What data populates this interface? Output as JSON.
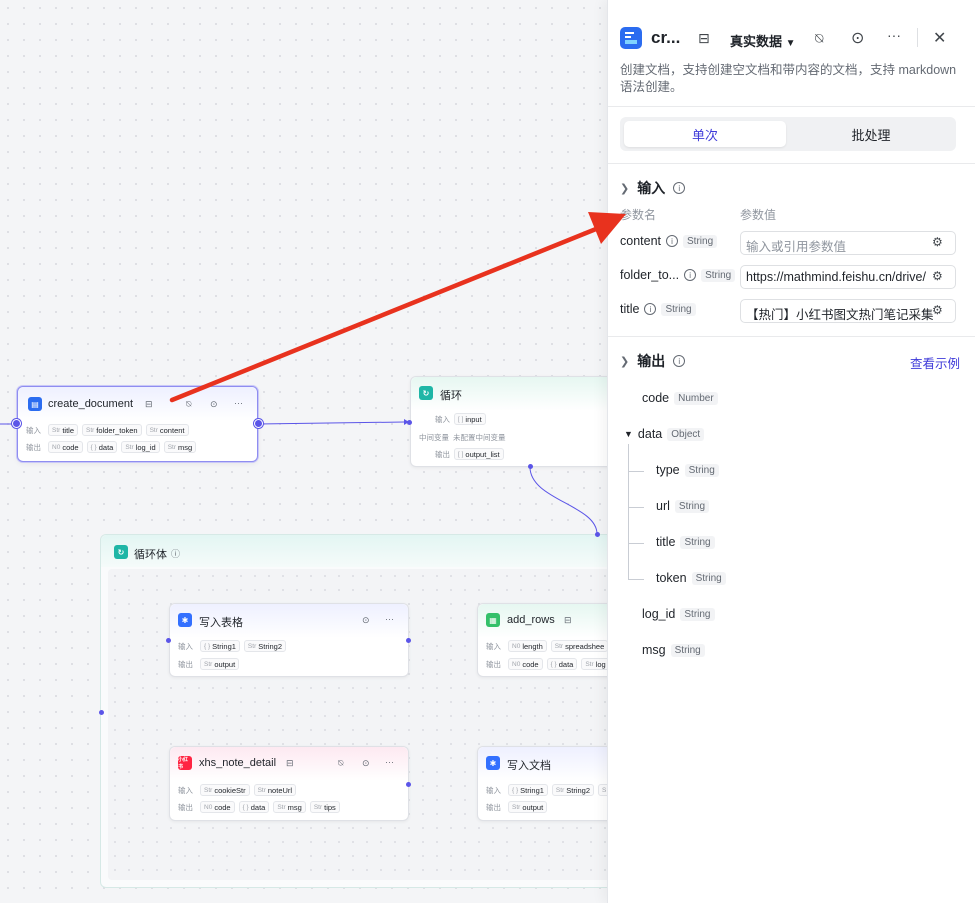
{
  "canvas": {
    "create_node": {
      "title": "create_document",
      "input_label": "输入",
      "output_label": "输出",
      "inputs": [
        {
          "type": "Str",
          "name": "title"
        },
        {
          "type": "Str",
          "name": "folder_token"
        },
        {
          "type": "Str",
          "name": "content"
        }
      ],
      "outputs": [
        {
          "type": "N0",
          "name": "code"
        },
        {
          "type": "{ }",
          "name": "data"
        },
        {
          "type": "Str",
          "name": "log_id"
        },
        {
          "type": "Str",
          "name": "msg"
        }
      ]
    },
    "loop_node": {
      "title": "循环",
      "input_label": "输入",
      "mid_label": "中间变量",
      "mid_value": "未配置中间变量",
      "output_label": "输出",
      "input_var": "input",
      "output_var": "output_list"
    },
    "loop_body": {
      "title": "循环体"
    },
    "write_table": {
      "title": "写入表格",
      "input_label": "输入",
      "output_label": "输出",
      "inputs": [
        {
          "type": "{ }",
          "name": "String1"
        },
        {
          "type": "Str",
          "name": "String2"
        }
      ],
      "outputs": [
        {
          "type": "Str",
          "name": "output"
        }
      ]
    },
    "add_rows": {
      "title": "add_rows",
      "input_label": "输入",
      "output_label": "输出",
      "inputs": [
        {
          "type": "N0",
          "name": "length"
        },
        {
          "type": "Str",
          "name": "spreadshee"
        }
      ],
      "outputs": [
        {
          "type": "N0",
          "name": "code"
        },
        {
          "type": "{ }",
          "name": "data"
        },
        {
          "type": "Str",
          "name": "log"
        }
      ]
    },
    "xhs_node": {
      "title": "xhs_note_detail",
      "input_label": "输入",
      "output_label": "输出",
      "inputs": [
        {
          "type": "Str",
          "name": "cookieStr"
        },
        {
          "type": "Str",
          "name": "noteUrl"
        }
      ],
      "outputs": [
        {
          "type": "N0",
          "name": "code"
        },
        {
          "type": "{ }",
          "name": "data"
        },
        {
          "type": "Str",
          "name": "msg"
        },
        {
          "type": "Str",
          "name": "tips"
        }
      ]
    },
    "write_doc": {
      "title": "写入文档",
      "input_label": "输入",
      "output_label": "输出",
      "inputs": [
        {
          "type": "{ }",
          "name": "String1"
        },
        {
          "type": "Str",
          "name": "String2"
        },
        {
          "type": "S",
          "name": ""
        }
      ],
      "outputs": [
        {
          "type": "Str",
          "name": "output"
        }
      ]
    }
  },
  "panel": {
    "title": "cr...",
    "data_mode": "真实数据",
    "description": "创建文档，支持创建空文档和带内容的文档，支持 markdown 语法创建。",
    "tabs": {
      "single": "单次",
      "batch": "批处理"
    },
    "input_section": {
      "title": "输入",
      "col_name": "参数名",
      "col_value": "参数值",
      "params": [
        {
          "name": "content",
          "type": "String",
          "value": "",
          "placeholder": "输入或引用参数值"
        },
        {
          "name": "folder_to...",
          "type": "String",
          "value": "https://mathmind.feishu.cn/drive/",
          "placeholder": ""
        },
        {
          "name": "title",
          "type": "String",
          "value": "【热门】小红书图文热门笔记采集",
          "placeholder": ""
        }
      ]
    },
    "output_section": {
      "title": "输出",
      "example_link": "查看示例",
      "fields": [
        {
          "name": "code",
          "type": "Number"
        },
        {
          "name": "data",
          "type": "Object"
        },
        {
          "name": "type",
          "type": "String"
        },
        {
          "name": "url",
          "type": "String"
        },
        {
          "name": "title",
          "type": "String"
        },
        {
          "name": "token",
          "type": "String"
        },
        {
          "name": "log_id",
          "type": "String"
        },
        {
          "name": "msg",
          "type": "String"
        }
      ]
    }
  },
  "colors": {
    "accent": "#5b55e8",
    "arrow": "#e8321e",
    "loop": "#1fb6a6"
  }
}
